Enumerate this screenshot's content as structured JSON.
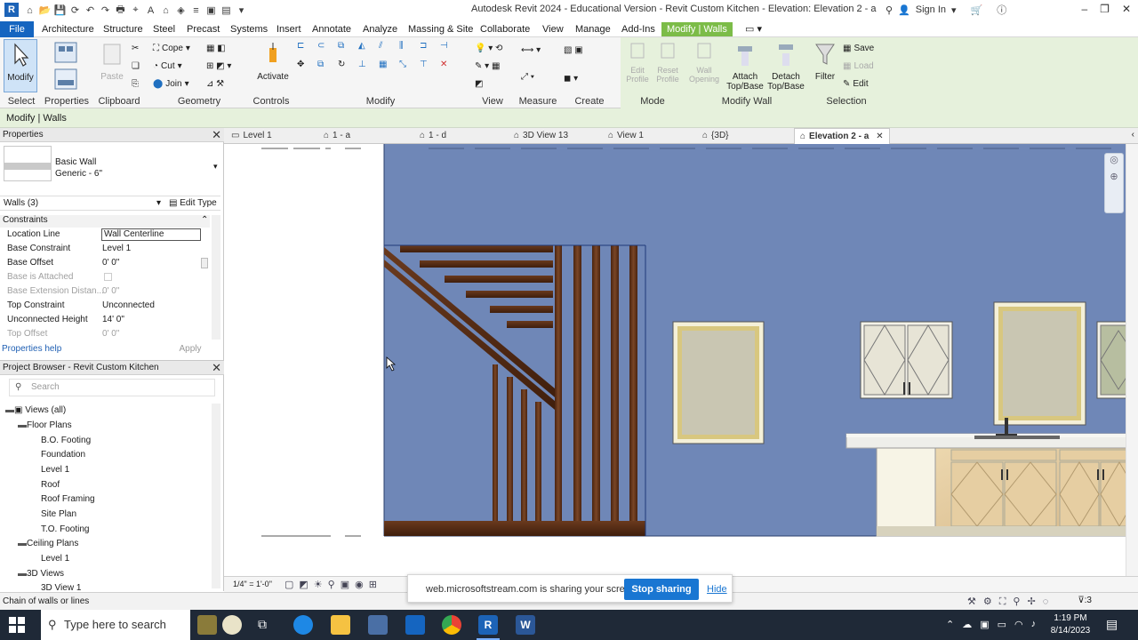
{
  "title_bar": {
    "app_logo": "R",
    "title": "Autodesk Revit 2024 - Educational Version - Revit Custom Kitchen - Elevation: Elevation 2 - a",
    "sign_in": "Sign In"
  },
  "menu": {
    "tabs": [
      "File",
      "Architecture",
      "Structure",
      "Steel",
      "Precast",
      "Systems",
      "Insert",
      "Annotate",
      "Analyze",
      "Massing & Site",
      "Collaborate",
      "View",
      "Manage",
      "Add-Ins",
      "Modify | Walls"
    ]
  },
  "ribbon": {
    "modify_label": "Modify",
    "select_label": "Select",
    "properties_label": "Properties",
    "clipboard_label": "Clipboard",
    "geometry_label": "Geometry",
    "cope_label": "Cope",
    "cut_label": "Cut",
    "join_label": "Join",
    "paste_label": "Paste",
    "controls_label": "Controls",
    "activate_label": "Activate",
    "modify_panel_label": "Modify",
    "view_label": "View",
    "measure_label": "Measure",
    "create_label": "Create",
    "mode_label": "Mode",
    "edit_profile_label": "Edit Profile",
    "reset_profile_label": "Reset Profile",
    "wall_opening_label": "Wall Opening",
    "attach_label": "Attach Top/Base",
    "detach_label": "Detach Top/Base",
    "modify_wall_label": "Modify Wall",
    "filter_label": "Filter",
    "save_label": "Save",
    "load_label": "Load",
    "edit_label": "Edit",
    "selection_label": "Selection"
  },
  "context_bar": {
    "text": "Modify | Walls"
  },
  "properties": {
    "title": "Properties",
    "type_family": "Basic Wall",
    "type_name": "Generic - 6\"",
    "selection": "Walls (3)",
    "edit_type": "Edit Type",
    "section": "Constraints",
    "rows": [
      {
        "key": "Location Line",
        "value": "Wall Centerline"
      },
      {
        "key": "Base Constraint",
        "value": "Level 1"
      },
      {
        "key": "Base Offset",
        "value": "0'  0\""
      },
      {
        "key": "Base is Attached",
        "value": ""
      },
      {
        "key": "Base Extension Distan...",
        "value": "0'  0\""
      },
      {
        "key": "Top Constraint",
        "value": "Unconnected"
      },
      {
        "key": "Unconnected Height",
        "value": "14'  0\""
      },
      {
        "key": "Top Offset",
        "value": "0'  0\""
      }
    ],
    "help": "Properties help",
    "apply": "Apply"
  },
  "browser": {
    "title": "Project Browser - Revit Custom Kitchen",
    "search_placeholder": "Search",
    "items": [
      "Views (all)",
      "Floor Plans",
      "B.O. Footing",
      "Foundation",
      "Level 1",
      "Roof",
      "Roof Framing",
      "Site Plan",
      "T.O. Footing",
      "Ceiling Plans",
      "Level 1",
      "3D Views",
      "3D View 1"
    ]
  },
  "view_tabs": [
    "Level 1",
    "1 - a",
    "1 - d",
    "3D View 13",
    "View 1",
    "{3D}",
    "Elevation 2 - a"
  ],
  "view_bar": {
    "scale": "1/4\" = 1'-0\""
  },
  "share": {
    "message": "web.microsoftstream.com is sharing your screen.",
    "stop": "Stop sharing",
    "hide": "Hide"
  },
  "status": {
    "text": "Chain of walls or lines",
    "filter_count": ":3"
  },
  "taskbar": {
    "search": "Type here to search",
    "time": "1:19 PM",
    "date": "8/14/2023"
  },
  "colors": {
    "wall_blue": "#6f87b7",
    "wood_dark": "#5a2d14",
    "cabinet_wood": "#e1c79a",
    "accent_blue": "#1976d2",
    "context_green": "#7cbc48"
  }
}
